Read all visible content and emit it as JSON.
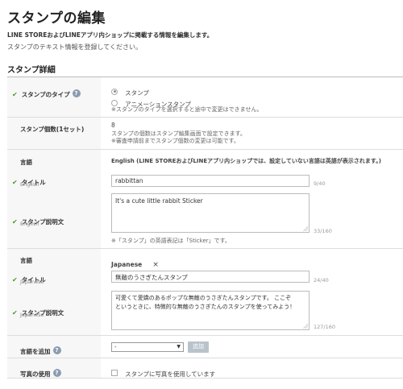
{
  "header": {
    "title": "スタンプの編集",
    "subtitle": "LINE STOREおよびLINEアプリ内ショップに掲載する情報を編集します。",
    "description": "スタンプのテキスト情報を登録してください。",
    "section_title": "スタンプ詳細"
  },
  "type_row": {
    "label": "スタンプのタイプ",
    "options": [
      "スタンプ",
      "アニメーションスタンプ"
    ],
    "selected": "スタンプ",
    "note": "※スタンプのタイプを選択すると途中で変更はできません。"
  },
  "count_row": {
    "label": "スタンプ個数(1セット)",
    "value": "8",
    "note1": "スタンプの個数はスタンプ編集画面で設定できます。",
    "note2": "※審査申請前までスタンプ個数の変更は可能です。"
  },
  "lang_en": {
    "label": "言語",
    "value": "English (LINE STOREおよびLINEアプリ内ショップでは、設定していない言語は英語が表示されます。)",
    "title_label": "タイトル",
    "title_sub": "English",
    "title_value": "rabbittan",
    "title_counter": "9/40",
    "desc_label": "スタンプ説明文",
    "desc_sub": "English",
    "desc_value": "It's a cute little rabbit Sticker",
    "desc_counter": "33/160",
    "desc_note": "※「スタンプ」の英語表記は「Sticker」です。"
  },
  "lang_ja": {
    "label": "言語",
    "value": "Japanese",
    "remove": "×",
    "title_label": "タイトル",
    "title_sub": "Japanese",
    "title_value": "無敵のうさぎたんスタンプ",
    "title_counter": "24/40",
    "desc_label": "スタンプ説明文",
    "desc_sub": "Japanese",
    "desc_line1": "可愛くて愛嬌のあるポップな無敵のうさぎたんスタンプです。 ここぞ",
    "desc_line2": "というときに、特徴的な無敵のうさぎたんのスタンプを使ってみよう！",
    "desc_counter": "127/160"
  },
  "add_lang": {
    "label": "言語を追加",
    "select_value": "-",
    "button": "追加"
  },
  "photo": {
    "label": "写真の使用",
    "checkbox_label": "スタンプに写真を使用しています"
  },
  "icons": {
    "check": "✔",
    "help": "?",
    "select_arrow": "▼"
  }
}
